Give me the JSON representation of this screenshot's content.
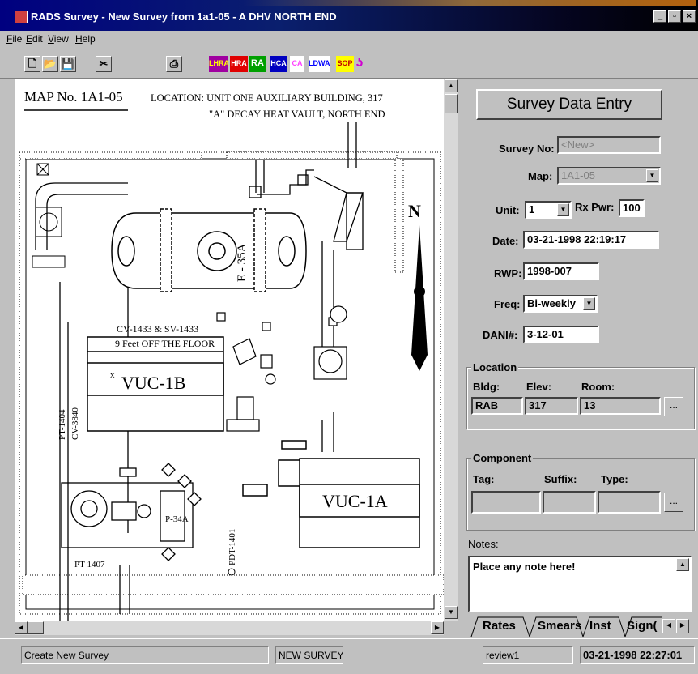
{
  "window": {
    "title": "RADS Survey - New Survey from 1a1-05 - A DHV NORTH END"
  },
  "menu": {
    "items": [
      {
        "label": "File",
        "u": "F",
        "rest": "ile"
      },
      {
        "label": "Edit",
        "u": "E",
        "rest": "dit"
      },
      {
        "label": "View",
        "u": "V",
        "rest": "iew"
      },
      {
        "label": "Help",
        "u": "H",
        "rest": "elp"
      }
    ]
  },
  "toolbar": {
    "lhra": "LHRA",
    "hra": "HRA",
    "ra": "RA",
    "hca": "HCA",
    "ca": "CA",
    "ldwa": "LDWA",
    "sop": "SOP"
  },
  "map": {
    "map_no": "MAP No. 1A1-05",
    "location_line1": "LOCATION: UNIT ONE AUXILIARY BUILDING, 317",
    "location_line2": "\"A\" DECAY HEAT VAULT, NORTH END",
    "north": "N",
    "e35a": "E - 35A",
    "cv_label": "CV-1433 & SV-1433",
    "feet_label": "9 Feet OFF THE FLOOR",
    "vuc1b": "VUC-1B",
    "vuc1a": "VUC-1A",
    "p34a": "P-34A",
    "pt1404": "PT-1404",
    "cv3840": "CV-3840",
    "pt1407": "PT-1407",
    "pdt1401": "PDT-1401",
    "x_mark": "x"
  },
  "form": {
    "header": "Survey Data Entry",
    "survey_no_label": "Survey No:",
    "survey_no_value": "<New>",
    "map_label": "Map:",
    "map_value": "1A1-05",
    "unit_label": "Unit:",
    "unit_value": "1",
    "rxpwr_label": "Rx Pwr:",
    "rxpwr_value": "100",
    "date_label": "Date:",
    "date_value": "03-21-1998 22:19:17",
    "rwp_label": "RWP:",
    "rwp_value": "1998-007",
    "freq_label": "Freq:",
    "freq_value": "Bi-weekly",
    "dani_label": "DANI#:",
    "dani_value": "3-12-01",
    "location": {
      "title": "Location",
      "bldg_label": "Bldg:",
      "bldg_value": "RAB",
      "elev_label": "Elev:",
      "elev_value": "317",
      "room_label": "Room:",
      "room_value": "13",
      "browse": "..."
    },
    "component": {
      "title": "Component",
      "tag_label": "Tag:",
      "suffix_label": "Suffix:",
      "type_label": "Type:",
      "browse": "..."
    },
    "notes_label": "Notes:",
    "notes_value": "Place any note here!",
    "tabs": [
      "Rates",
      "Smears",
      "Inst",
      "Sign("
    ]
  },
  "status": {
    "p1": "Create New Survey",
    "p2": "NEW SURVEY",
    "p3": "review1",
    "p4": "03-21-1998  22:27:01"
  },
  "colors": {
    "titlebar": "#000080",
    "lhra": "#a000a0",
    "hra": "#e00000",
    "ra": "#00a000",
    "hca": "#0000c0",
    "ca": "#ff40ff",
    "ldwa": "#0000ff",
    "sop": "#c00000"
  }
}
